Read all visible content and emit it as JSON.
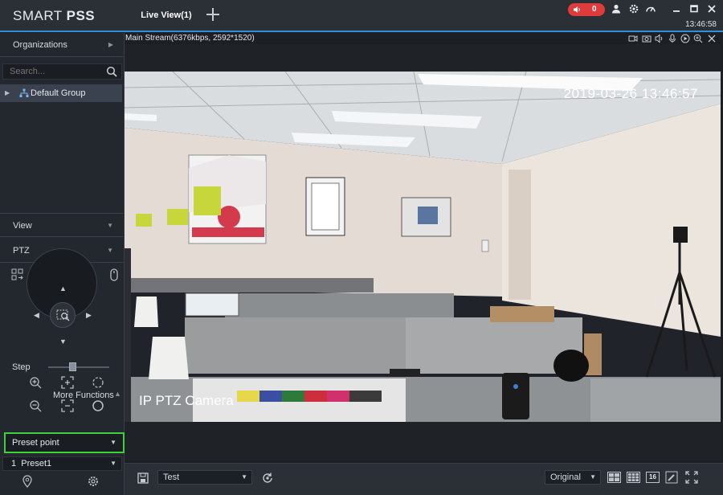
{
  "app": {
    "logo_light": "SMART ",
    "logo_bold": "PSS",
    "clock": "13:46:58",
    "alarm_count": "0"
  },
  "tabs": [
    {
      "label": "Live View(1)",
      "active": true
    }
  ],
  "sidebar": {
    "organizations_label": "Organizations",
    "search_placeholder": "Search...",
    "group_label": "Default Group",
    "view_label": "View",
    "ptz_label": "PTZ",
    "step_label": "Step",
    "step_value": 0.4,
    "more_functions_label": "More Functions",
    "preset_mode": "Preset point",
    "preset_selected": "1  Preset1"
  },
  "video": {
    "stream_info": "Main Stream(6376kbps, 2592*1520)",
    "osd_timestamp": "2019-03-26 13:46:57",
    "osd_camera_name": "IP PTZ Camera"
  },
  "toolbar": {
    "view_name": "Test",
    "display_mode": "Original",
    "layout_16_label": "16"
  },
  "colors": {
    "accent_blue": "#2f8fd9",
    "alarm_red": "#e03b3b",
    "highlight_green": "#3dd13d"
  }
}
